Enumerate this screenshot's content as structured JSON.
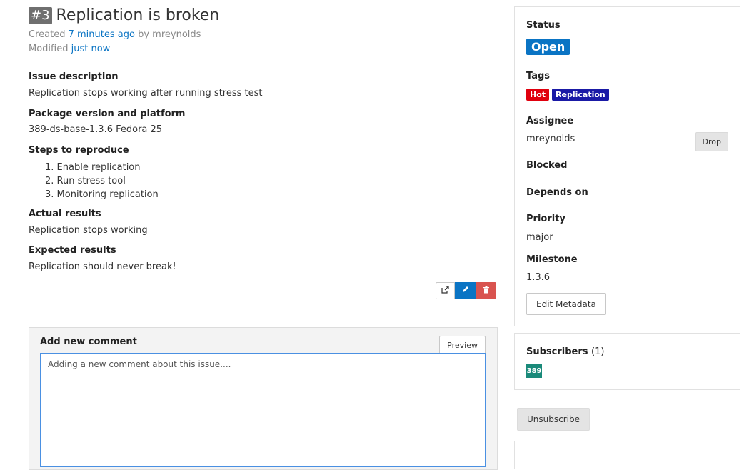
{
  "issue": {
    "number": "#3",
    "title": "Replication is broken",
    "created_label": "Created",
    "created_time": "7 minutes ago",
    "created_by_label": "by",
    "created_by": "mreynolds",
    "modified_label": "Modified",
    "modified_time": "just now"
  },
  "sections": {
    "description": {
      "heading": "Issue description",
      "text": "Replication stops working after running stress test"
    },
    "package": {
      "heading": "Package version and platform",
      "text": "389-ds-base-1.3.6 Fedora 25"
    },
    "steps": {
      "heading": "Steps to reproduce",
      "items": [
        "1. Enable replication",
        "2. Run stress tool",
        "3. Monitoring replication"
      ]
    },
    "actual": {
      "heading": "Actual results",
      "text": "Replication stops working"
    },
    "expected": {
      "heading": "Expected results",
      "text": "Replication should never break!"
    }
  },
  "actions": {
    "share_icon": "share-icon",
    "edit_icon": "pencil-icon",
    "delete_icon": "trash-icon"
  },
  "comment": {
    "heading": "Add new comment",
    "preview_label": "Preview",
    "value": "Adding a new comment about this issue...."
  },
  "sidebar": {
    "status_heading": "Status",
    "status_value": "Open",
    "tags_heading": "Tags",
    "tags": [
      {
        "label": "Hot",
        "color": "#e0000e"
      },
      {
        "label": "Replication",
        "color": "#1a1aa6"
      }
    ],
    "assignee_heading": "Assignee",
    "assignee": "mreynolds",
    "drop_label": "Drop",
    "blocked_heading": "Blocked",
    "depends_heading": "Depends on",
    "priority_heading": "Priority",
    "priority_value": "major",
    "milestone_heading": "Milestone",
    "milestone_value": "1.3.6",
    "edit_metadata_label": "Edit Metadata",
    "subscribers_heading": "Subscribers",
    "subscribers_count": "(1)",
    "subscriber_avatar": "389",
    "unsubscribe_label": "Unsubscribe"
  },
  "colors": {
    "accent": "#0a74c4",
    "danger": "#d9534f"
  }
}
